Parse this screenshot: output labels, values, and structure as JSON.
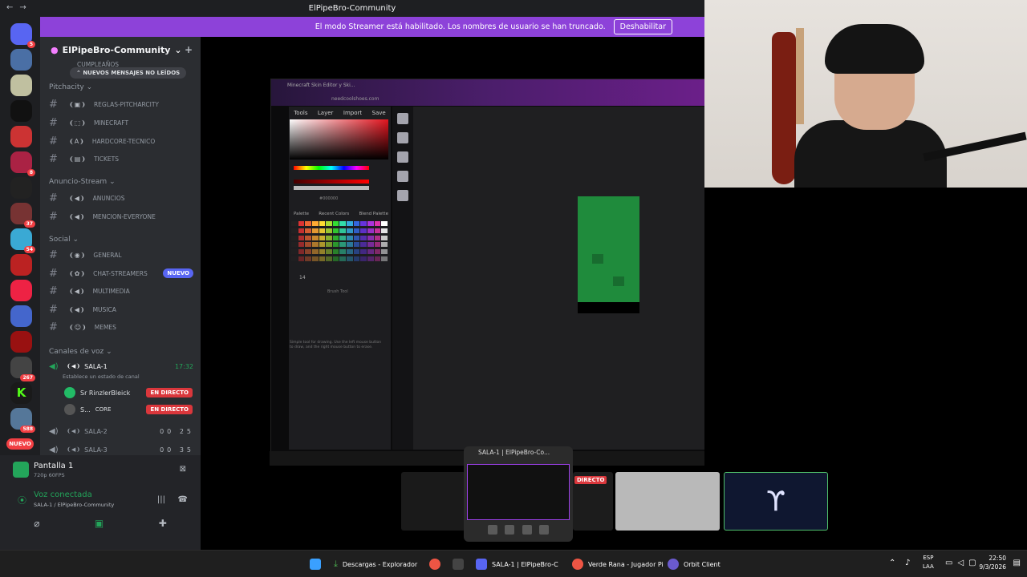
{
  "window": {
    "title": "ElPipeBro-Community"
  },
  "streamer_bar": {
    "message": "El modo Streamer está habilitado. Los nombres de usuario se han truncado.",
    "button": "Deshabilitar"
  },
  "server": {
    "name": "ElPipeBro-Community",
    "unread_pill": "NUEVOS MENSAJES NO LEÍDOS"
  },
  "guild_badges": {
    "g1": "5",
    "g2": "8",
    "g3": "37",
    "g4": "54",
    "g5": "267",
    "g6": "588",
    "new": "NUEVO"
  },
  "categories": {
    "pitchacity": "Pitchacity",
    "anuncio": "Anuncio-Stream",
    "social": "Social",
    "voz": "Canales de voz"
  },
  "channels": {
    "cumpleanos": "CUMPLEAÑOS",
    "reglas": "REGLAS-PITCHARCITY",
    "minecraft": "MINECRAFT",
    "hardcore": "HARDCORE-TECNICO",
    "tickets": "TICKETS",
    "anuncios": "ANUNCIOS",
    "mencion": "MENCION-EVERYONE",
    "general": "GENERAL",
    "chat": "CHAT-STREAMERS",
    "chat_badge": "NUEVO",
    "multimedia": "MULTIMEDIA",
    "musica": "MUSICA",
    "memes": "MEMES"
  },
  "voice": {
    "sala1": "SALA-1",
    "sala1_time": "17:32",
    "sala1_status": "Establece un estado de canal",
    "user1": "Sr RinzlerBleick",
    "user2": "S...",
    "user2_tag": "CORE",
    "live_label": "EN DIRECTO",
    "sala2": "SALA-2",
    "sala2_count": "00 25",
    "sala3": "SALA-3",
    "sala3_count": "00 35"
  },
  "rtc": {
    "screen_title": "Pantalla 1",
    "screen_sub": "720p 60FPS",
    "voice_connected": "Voz conectada",
    "voice_path": "SALA-1 / ElPipeBro-Community"
  },
  "editor": {
    "tab": "Minecraft Skin Editor y Ski...",
    "url": "needcoolshoes.com",
    "tabs": [
      "Tools",
      "Layer",
      "Import",
      "Save"
    ],
    "hex": "#000000",
    "palette_tabs": [
      "Palette",
      "Recent Colors",
      "Blend Palette"
    ],
    "brush_size": "14",
    "brush_label": "Brush Tool",
    "tool_desc": "Simple tool for drawing. Use the left mouse button to draw, and the right mouse button to erase."
  },
  "popup": {
    "title": "SALA-1 | ElPipeBro-Co...",
    "live": "DIRECTO"
  },
  "taskbar": {
    "items": [
      "Descargas - Explorador",
      "SALA-1 | ElPipeBro-C",
      "Verde Rana - Jugador Pi",
      "Orbit Client"
    ],
    "lang": "ESP",
    "lang2": "LAA",
    "time": "22:50",
    "date": "9/3/2026"
  }
}
